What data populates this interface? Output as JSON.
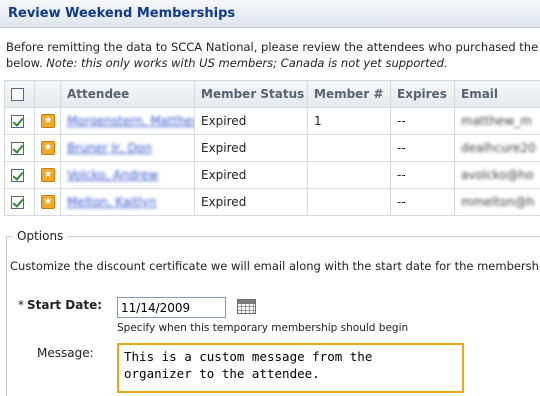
{
  "header": {
    "title": "Review Weekend Memberships"
  },
  "intro": {
    "text": "Before remitting the data to SCCA National, please review the attendees who purchased the invent",
    "line2_plain": "below. ",
    "line2_note": "Note: this only works with US members; Canada is not yet supported."
  },
  "table": {
    "columns": [
      "",
      "",
      "Attendee",
      "Member Status",
      "Member #",
      "Expires",
      "Email"
    ],
    "rows": [
      {
        "checked": true,
        "attendee": "Morgenstern, Matthew",
        "status": "Expired",
        "member_no": "1",
        "expires": "--",
        "email": "matthew_m"
      },
      {
        "checked": true,
        "attendee": "Bruner Jr, Don",
        "status": "Expired",
        "member_no": "",
        "expires": "--",
        "email": "dealhcure20"
      },
      {
        "checked": true,
        "attendee": "Volcko, Andrew",
        "status": "Expired",
        "member_no": "",
        "expires": "--",
        "email": "avolcko@ho"
      },
      {
        "checked": true,
        "attendee": "Melton, Kaitlyn",
        "status": "Expired",
        "member_no": "",
        "expires": "--",
        "email": "mmelton@h"
      }
    ]
  },
  "options": {
    "legend": "Options",
    "description": "Customize the discount certificate we will email along with the start date for the memberships.",
    "start_date": {
      "required_mark": "*",
      "label": "Start Date:",
      "value": "11/14/2009",
      "hint": "Specify when this temporary membership should begin"
    },
    "message": {
      "label": "Message:",
      "value": "This is a custom message from the\norganizer to the attendee."
    }
  },
  "colors": {
    "title": "#0f3b86",
    "accent_border": "#e8a817",
    "link": "#3355cc"
  }
}
